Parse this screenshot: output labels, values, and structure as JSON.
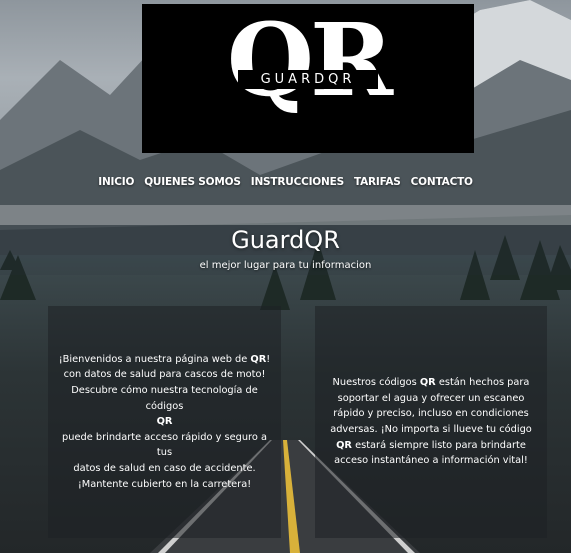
{
  "logo": {
    "letters": "QR",
    "subtitle": "GUARDQR"
  },
  "nav": {
    "items": [
      "INICIO",
      "QUIENES SOMOS",
      "INSTRUCCIONES",
      "TARIFAS",
      "CONTACTO"
    ]
  },
  "hero": {
    "title": "GuardQR",
    "subtitle": "el mejor lugar para tu informacion"
  },
  "cards": {
    "left": {
      "l1a": "¡Bienvenidos a nuestra página web de ",
      "l1b": "QR",
      "l1c": "!",
      "l2": "con datos de salud para cascos de moto!",
      "l3": "Descubre cómo nuestra tecnología de códigos",
      "l4": "QR",
      "l5": "puede brindarte acceso rápido y seguro a tus",
      "l6": "datos de salud en caso de accidente.",
      "l7": "¡Mantente cubierto en la carretera!"
    },
    "right": {
      "p1a": "Nuestros códigos ",
      "p1b": "QR",
      "p1c": " están hechos para soportar el agua y ofrecer un escaneo rápido y preciso, incluso en condiciones adversas. ¡No importa si llueve tu código ",
      "p1d": "QR",
      "p1e": " estará siempre listo para brindarte acceso instantáneo a información vital!"
    }
  },
  "colors": {
    "logo_background": "#000000",
    "text": "#ffffff",
    "card_background": "rgba(30,33,36,0.55)"
  }
}
